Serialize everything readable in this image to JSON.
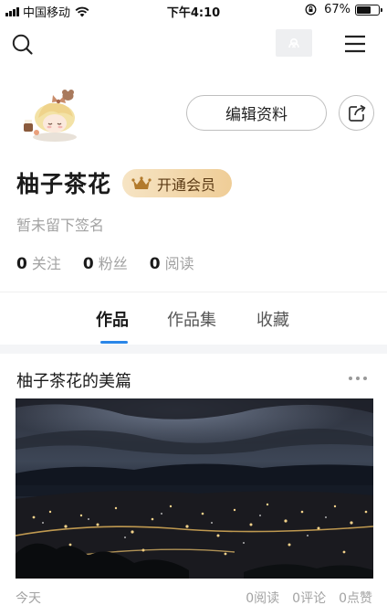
{
  "status_bar": {
    "carrier": "中国移动",
    "time": "下午4:10",
    "battery": "67%",
    "battery_level": 0.67
  },
  "top_nav": {
    "icons": [
      "search-icon",
      "face-icon",
      "menu-icon"
    ]
  },
  "profile": {
    "edit_label": "编辑资料",
    "username": "柚子茶花",
    "vip_label": "开通会员",
    "signature": "暂未留下签名",
    "stats": [
      {
        "value": "0",
        "label": "关注"
      },
      {
        "value": "0",
        "label": "粉丝"
      },
      {
        "value": "0",
        "label": "阅读"
      }
    ]
  },
  "tabs": [
    {
      "label": "作品",
      "active": true
    },
    {
      "label": "作品集",
      "active": false
    },
    {
      "label": "收藏",
      "active": false
    }
  ],
  "article": {
    "title": "柚子茶花的美篇",
    "date": "今天",
    "reads": "0阅读",
    "comments": "0评论",
    "likes": "0点赞"
  },
  "colors": {
    "accent": "#2a86e8",
    "vip_gold": "#efcd97",
    "muted_text": "#a3a3a3"
  }
}
